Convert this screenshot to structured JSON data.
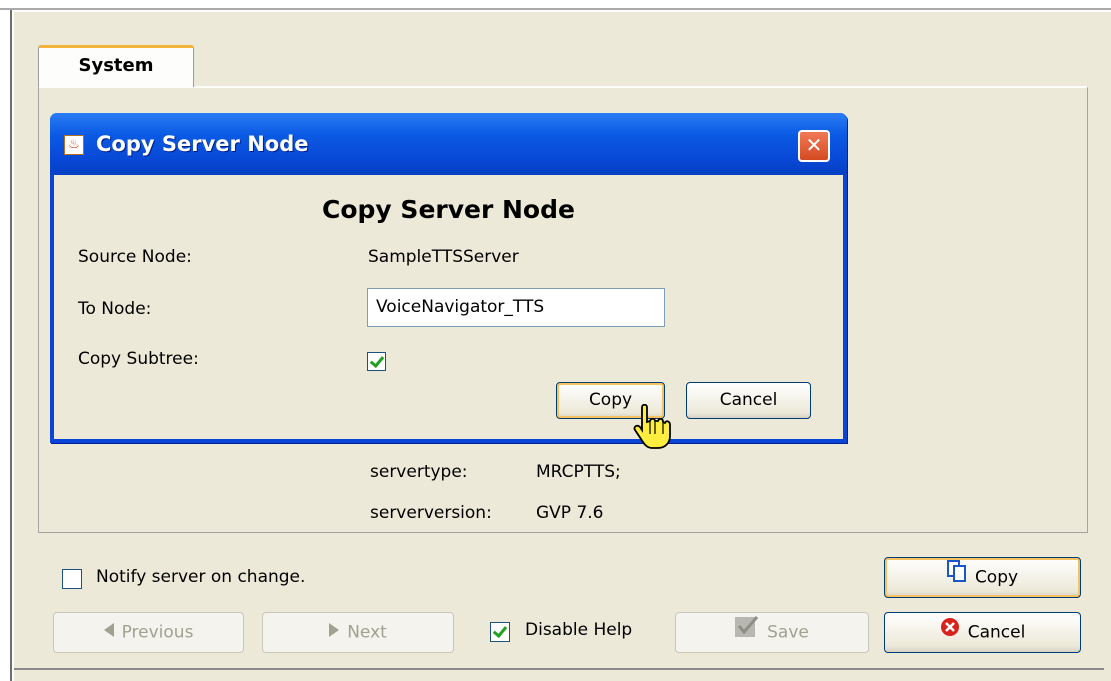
{
  "tabs": [
    {
      "label": "System"
    }
  ],
  "properties": [
    {
      "key": "servertype:",
      "value": "MRCPTTS;"
    },
    {
      "key": "serverversion:",
      "value": "GVP 7.6"
    }
  ],
  "dialog": {
    "title": "Copy Server Node",
    "heading": "Copy Server Node",
    "source_label": "Source Node:",
    "source_value": "SampleTTSServer",
    "to_label": "To Node:",
    "to_value": "VoiceNavigator_TTS",
    "subtree_label": "Copy Subtree:",
    "subtree_checked": true,
    "copy_label": "Copy",
    "cancel_label": "Cancel"
  },
  "footer": {
    "notify_label": "Notify server on change.",
    "notify_checked": false,
    "disable_help_label": "Disable Help",
    "disable_help_checked": true,
    "previous_label": "Previous",
    "next_label": "Next",
    "save_label": "Save",
    "copy_label": "Copy",
    "cancel_label": "Cancel"
  },
  "icons": {
    "title": "java-app-icon",
    "close": "close-icon",
    "previous": "arrow-left-icon",
    "next": "arrow-right-icon",
    "save": "save-check-icon",
    "copy": "copy-icon",
    "cancel": "cancel-icon",
    "cursor": "hand-pointer-icon"
  },
  "colors": {
    "titlebar": "#0b5ae4",
    "focus_ring": "#f5c260",
    "close_button": "#d54a22",
    "tab_accent": "#f5b43c"
  }
}
